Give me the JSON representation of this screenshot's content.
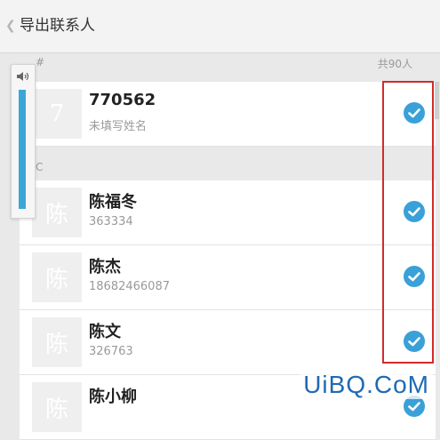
{
  "header": {
    "title": "导出联系人"
  },
  "sections": [
    {
      "letter": "#",
      "count": "共90人"
    },
    {
      "letter": "C"
    }
  ],
  "contacts": [
    {
      "avatar": "7",
      "name": "770562",
      "sub": "未填写姓名",
      "checked": true
    },
    {
      "avatar": "陈",
      "name": "陈福冬",
      "sub": "363334",
      "checked": true
    },
    {
      "avatar": "陈",
      "name": "陈杰",
      "sub": "18682466087",
      "checked": true
    },
    {
      "avatar": "陈",
      "name": "陈文",
      "sub": "326763",
      "checked": true
    },
    {
      "avatar": "陈",
      "name": "陈小柳",
      "sub": "",
      "checked": true
    }
  ],
  "watermark": "UiBQ.CoM",
  "colors": {
    "check": "#3aa0d8",
    "highlight": "#d22a2a",
    "volume_bar": "#3aa6d8"
  }
}
